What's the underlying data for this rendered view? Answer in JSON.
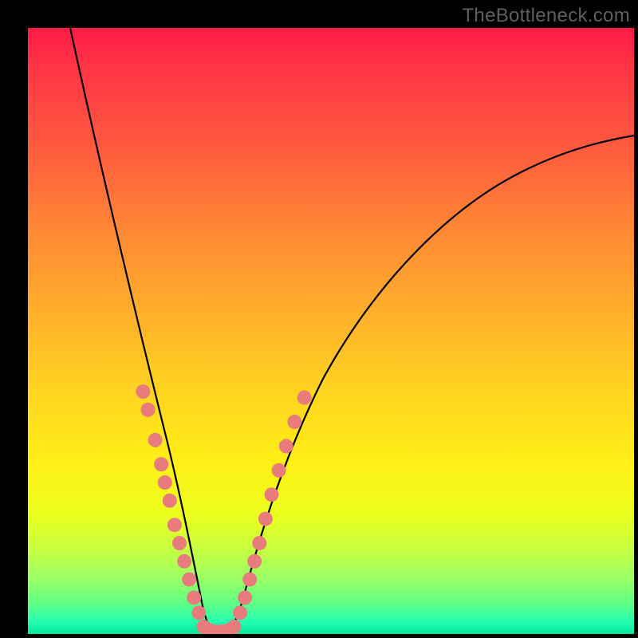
{
  "watermark": "TheBottleneck.com",
  "colors": {
    "frame": "#000000",
    "dot": "#e87b7b",
    "curve": "#000000",
    "gradient_top": "#ff1a45",
    "gradient_bottom": "#05e699"
  },
  "chart_data": {
    "type": "line",
    "title": "",
    "xlabel": "",
    "ylabel": "",
    "xlim": [
      0,
      100
    ],
    "ylim": [
      0,
      100
    ],
    "note": "No visible axis ticks or numeric labels; values are approximate normalized 0-100 readings along each axis.",
    "series": [
      {
        "name": "left-branch",
        "x": [
          7,
          9,
          11,
          13,
          15,
          17,
          19,
          21,
          22.5,
          24,
          25.5,
          27,
          28,
          29
        ],
        "y": [
          100,
          88,
          76,
          65,
          55,
          46,
          38,
          30,
          24,
          18,
          12,
          7,
          3,
          1
        ]
      },
      {
        "name": "valley-floor",
        "x": [
          29,
          30,
          31,
          32,
          33,
          34
        ],
        "y": [
          0.6,
          0.3,
          0.2,
          0.2,
          0.3,
          0.6
        ]
      },
      {
        "name": "right-branch",
        "x": [
          34,
          36,
          38,
          41,
          45,
          50,
          56,
          63,
          71,
          80,
          90,
          100
        ],
        "y": [
          1,
          6,
          13,
          22,
          33,
          44,
          54,
          63,
          70,
          75,
          79,
          82
        ]
      }
    ],
    "markers": [
      {
        "series": "left-cluster",
        "x": 19.0,
        "y": 40
      },
      {
        "series": "left-cluster",
        "x": 19.8,
        "y": 37
      },
      {
        "series": "left-cluster",
        "x": 21.0,
        "y": 32
      },
      {
        "series": "left-cluster",
        "x": 22.0,
        "y": 28
      },
      {
        "series": "left-cluster",
        "x": 22.6,
        "y": 25
      },
      {
        "series": "left-cluster",
        "x": 23.4,
        "y": 22
      },
      {
        "series": "left-cluster",
        "x": 24.2,
        "y": 18
      },
      {
        "series": "left-cluster",
        "x": 25.0,
        "y": 15
      },
      {
        "series": "left-cluster",
        "x": 25.8,
        "y": 12
      },
      {
        "series": "left-cluster",
        "x": 26.6,
        "y": 9
      },
      {
        "series": "left-cluster",
        "x": 27.4,
        "y": 6
      },
      {
        "series": "left-cluster",
        "x": 28.2,
        "y": 3.5
      },
      {
        "series": "floor-cluster",
        "x": 29.0,
        "y": 1.2
      },
      {
        "series": "floor-cluster",
        "x": 30.0,
        "y": 0.6
      },
      {
        "series": "floor-cluster",
        "x": 31.0,
        "y": 0.4
      },
      {
        "series": "floor-cluster",
        "x": 32.0,
        "y": 0.4
      },
      {
        "series": "floor-cluster",
        "x": 33.0,
        "y": 0.6
      },
      {
        "series": "floor-cluster",
        "x": 34.0,
        "y": 1.2
      },
      {
        "series": "right-cluster",
        "x": 35.0,
        "y": 3.5
      },
      {
        "series": "right-cluster",
        "x": 35.8,
        "y": 6
      },
      {
        "series": "right-cluster",
        "x": 36.6,
        "y": 9
      },
      {
        "series": "right-cluster",
        "x": 37.4,
        "y": 12
      },
      {
        "series": "right-cluster",
        "x": 38.2,
        "y": 15
      },
      {
        "series": "right-cluster",
        "x": 39.2,
        "y": 19
      },
      {
        "series": "right-cluster",
        "x": 40.2,
        "y": 23
      },
      {
        "series": "right-cluster",
        "x": 41.4,
        "y": 27
      },
      {
        "series": "right-cluster",
        "x": 42.6,
        "y": 31
      },
      {
        "series": "right-cluster",
        "x": 44.0,
        "y": 35
      },
      {
        "series": "right-cluster",
        "x": 45.6,
        "y": 39
      }
    ]
  }
}
